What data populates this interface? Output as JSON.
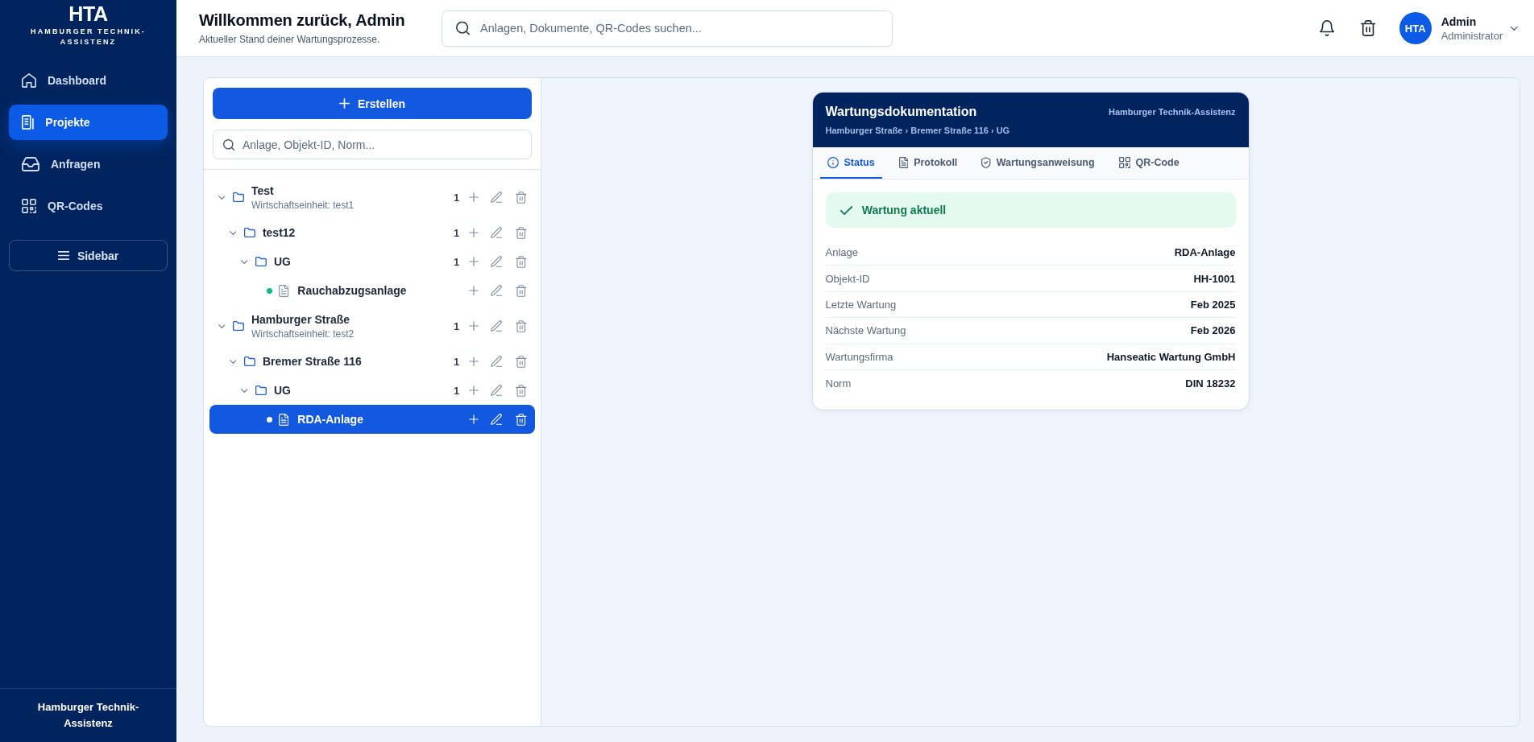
{
  "sidebar": {
    "logo": "HTA",
    "tagline": "HAMBURGER TECHNIK-ASSISTENZ",
    "nav": [
      {
        "label": "Dashboard",
        "selected": false
      },
      {
        "label": "Projekte",
        "selected": true
      },
      {
        "label": "Anfragen",
        "selected": false
      },
      {
        "label": "QR-Codes",
        "selected": false
      }
    ],
    "toggle_button": "Sidebar",
    "footer": "Hamburger Technik-Assistenz"
  },
  "header": {
    "title": "Willkommen zurück, Admin",
    "subtitle": "Aktueller Stand deiner Wartungsprozesse.",
    "search": {
      "placeholder": "Anlagen, Dokumente, QR-Codes suchen..."
    },
    "user": {
      "avatar": "HTA",
      "name": "Admin",
      "role": "Administrator"
    }
  },
  "tree_panel": {
    "create_button": "Erstellen",
    "search": {
      "placeholder": "Anlage, Objekt-ID, Norm..."
    },
    "tree": [
      {
        "kind": "folder",
        "label": "Test",
        "subtitle": "Wirtschaftseinheit: test1",
        "count": "1",
        "expanded": true,
        "selected": false,
        "children": [
          {
            "kind": "folder",
            "label": "test12",
            "count": "1",
            "expanded": true,
            "selected": false,
            "children": [
              {
                "kind": "folder",
                "label": "UG",
                "count": "1",
                "expanded": true,
                "selected": false,
                "children": [
                  {
                    "kind": "file",
                    "label": "Rauchabzugsanlage",
                    "color": "#10b981",
                    "selected": false
                  }
                ]
              }
            ]
          }
        ]
      },
      {
        "kind": "folder",
        "label": "Hamburger Straße",
        "subtitle": "Wirtschaftseinheit: test2",
        "count": "1",
        "expanded": true,
        "selected": false,
        "children": [
          {
            "kind": "folder",
            "label": "Bremer Straße 116",
            "count": "1",
            "expanded": true,
            "selected": false,
            "children": [
              {
                "kind": "folder",
                "label": "UG",
                "count": "1",
                "expanded": true,
                "selected": false,
                "children": [
                  {
                    "kind": "file",
                    "label": "RDA-Anlage",
                    "color": "#ffffff",
                    "selected": true
                  }
                ]
              }
            ]
          }
        ]
      }
    ]
  },
  "card": {
    "title": "Wartungsdokumentation",
    "brand": "Hamburger Technik-Assistenz",
    "breadcrumb": "Hamburger Straße › Bremer Straße 116 › UG",
    "tabs": [
      {
        "label": "Status",
        "selected": true
      },
      {
        "label": "Protokoll",
        "selected": false
      },
      {
        "label": "Wartungsanweisung",
        "selected": false
      },
      {
        "label": "QR-Code",
        "selected": false
      }
    ],
    "status": {
      "kind": "ok",
      "label": "Wartung aktuell"
    },
    "fields": [
      {
        "label": "Anlage",
        "value": "RDA-Anlage"
      },
      {
        "label": "Objekt-ID",
        "value": "HH-1001"
      },
      {
        "label": "Letzte Wartung",
        "value": "Feb 2025"
      },
      {
        "label": "Nächste Wartung",
        "value": "Feb 2026"
      },
      {
        "label": "Wartungsfirma",
        "value": "Hanseatic Wartung GmbH"
      },
      {
        "label": "Norm",
        "value": "DIN 18232"
      }
    ]
  }
}
